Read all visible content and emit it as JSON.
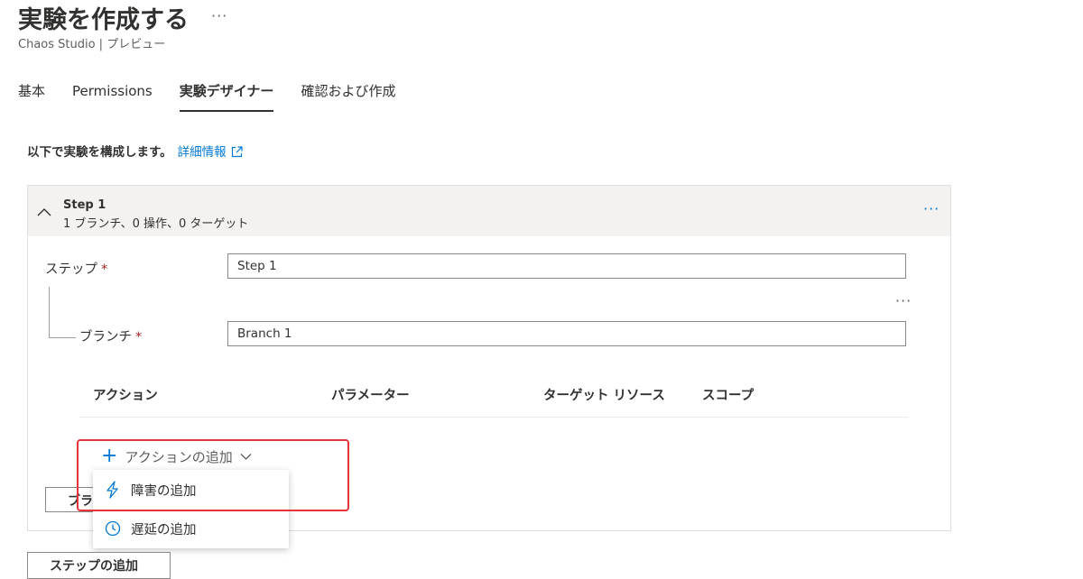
{
  "header": {
    "title": "実験を作成する",
    "more": "···",
    "subtitle": "Chaos Studio | プレビュー"
  },
  "tabs": [
    {
      "label": "基本"
    },
    {
      "label": "Permissions"
    },
    {
      "label": "実験デザイナー",
      "active": true
    },
    {
      "label": "確認および作成"
    }
  ],
  "intro": {
    "text": "以下で実験を構成します。",
    "link": "詳細情報"
  },
  "step": {
    "name": "Step 1",
    "summary": "1 ブランチ、0 操作、0 ターゲット",
    "more": "···",
    "step_label": "ステップ",
    "step_value": "Step 1",
    "branch_label": "ブランチ",
    "branch_value": "Branch 1",
    "branch_more": "···",
    "required_mark": "*"
  },
  "table": {
    "headers": [
      "アクション",
      "パラメーター",
      "ターゲット リソース",
      "スコープ"
    ]
  },
  "add_action": {
    "label": "アクションの追加",
    "menu": [
      {
        "label": "障害の追加",
        "icon": "lightning-icon"
      },
      {
        "label": "遅延の追加",
        "icon": "clock-icon"
      }
    ]
  },
  "buttons": {
    "add_branch_partial": "ブラ",
    "add_step": "ステップの追加"
  },
  "colors": {
    "accent": "#0078d4",
    "highlight": "#e8333b",
    "header_bg": "#f3f2f1",
    "required": "#a4262c"
  }
}
